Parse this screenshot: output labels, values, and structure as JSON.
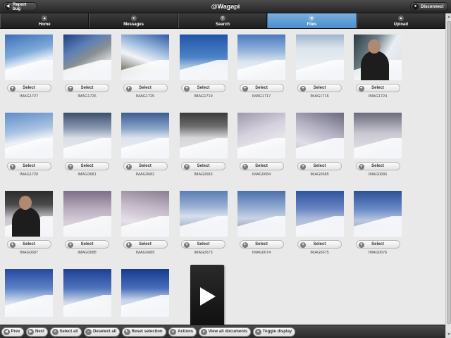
{
  "header": {
    "title": "@Wagapi",
    "report_bug": "Report bug",
    "disconnect": "Disconnect"
  },
  "nav": [
    {
      "label": "Home",
      "icon": "home-icon",
      "active": false
    },
    {
      "label": "Messages",
      "icon": "messages-icon",
      "active": false
    },
    {
      "label": "Search",
      "icon": "search-icon",
      "active": false
    },
    {
      "label": "Files",
      "icon": "files-icon",
      "active": true
    },
    {
      "label": "Upload",
      "icon": "upload-icon",
      "active": false
    }
  ],
  "select_label": "Select",
  "files": [
    {
      "name": "IMAG1727",
      "style": "p-a"
    },
    {
      "name": "IMAG1726",
      "style": "p-b"
    },
    {
      "name": "IMAG1725",
      "style": "p-c"
    },
    {
      "name": "IMAG1719",
      "style": "p-d"
    },
    {
      "name": "IMAG1717",
      "style": "p-e"
    },
    {
      "name": "IMAG1716",
      "style": "p-f"
    },
    {
      "name": "IMAG1724",
      "style": "p-g"
    },
    {
      "name": "IMAG1720",
      "style": "p-h"
    },
    {
      "name": "IMAG0681",
      "style": "p-i"
    },
    {
      "name": "IMAG0682",
      "style": "p-j"
    },
    {
      "name": "IMAG0683",
      "style": "p-k"
    },
    {
      "name": "IMAG0684",
      "style": "p-l"
    },
    {
      "name": "IMAG0685",
      "style": "p-m"
    },
    {
      "name": "IMAG0686",
      "style": "p-n"
    },
    {
      "name": "IMAG0687",
      "style": "p-o"
    },
    {
      "name": "IMAG0688",
      "style": "p-p"
    },
    {
      "name": "IMAG0689",
      "style": "p-q"
    },
    {
      "name": "IMAG0673",
      "style": "p-r"
    },
    {
      "name": "IMAG0674",
      "style": "p-s"
    },
    {
      "name": "IMAG0675",
      "style": "p-t"
    },
    {
      "name": "IMAG0676",
      "style": "p-u"
    }
  ],
  "partial_files": [
    {
      "style": "p-v"
    },
    {
      "style": "p-w"
    },
    {
      "style": "p-x"
    }
  ],
  "toolbar": [
    {
      "label": "Prev",
      "icon": "prev-icon"
    },
    {
      "label": "Next",
      "icon": "next-icon"
    },
    {
      "label": "Select all",
      "icon": "select-all-icon"
    },
    {
      "label": "Deselect all",
      "icon": "deselect-all-icon"
    },
    {
      "label": "Reset selection",
      "icon": "reset-icon"
    },
    {
      "label": "Actions",
      "icon": "actions-icon"
    },
    {
      "label": "View all documents",
      "icon": "view-all-icon"
    },
    {
      "label": "Toggle display",
      "icon": "toggle-icon"
    }
  ]
}
